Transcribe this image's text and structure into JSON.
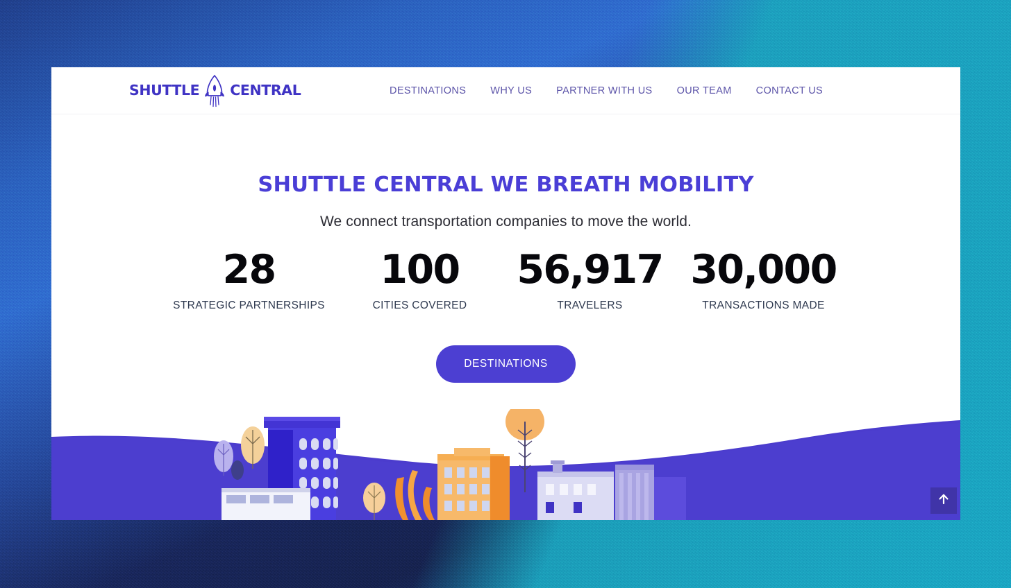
{
  "brand": {
    "word_left": "SHUTTLE",
    "word_right": "CENTRAL",
    "icon": "rocket-icon",
    "color": "#3f33c4"
  },
  "nav": {
    "items": [
      {
        "label": "DESTINATIONS"
      },
      {
        "label": "WHY US"
      },
      {
        "label": "PARTNER WITH US"
      },
      {
        "label": "OUR TEAM"
      },
      {
        "label": "CONTACT US"
      }
    ]
  },
  "hero": {
    "headline": "SHUTTLE CENTRAL WE BREATH MOBILITY",
    "subhead": "We connect transportation companies to move the world.",
    "headline_color": "#4a3ed6"
  },
  "stats": [
    {
      "value": "28",
      "label": "STRATEGIC PARTNERSHIPS"
    },
    {
      "value": "100",
      "label": "CITIES COVERED"
    },
    {
      "value": "56,917",
      "label": "TRAVELERS"
    },
    {
      "value": "30,000",
      "label": "TRANSACTIONS MADE"
    }
  ],
  "cta": {
    "label": "DESTINATIONS",
    "background": "#4c3fd2",
    "text_color": "#ffffff"
  },
  "scroll_top": {
    "icon": "arrow-up-icon",
    "background": "#4034a8"
  },
  "illustration": {
    "name": "city-skyline-illustration",
    "wave_color": "#4b3ccd"
  },
  "backdrop": {
    "colors": [
      "#1f3f8f",
      "#2f6fd6",
      "#14214f",
      "#1aa8c4"
    ]
  }
}
